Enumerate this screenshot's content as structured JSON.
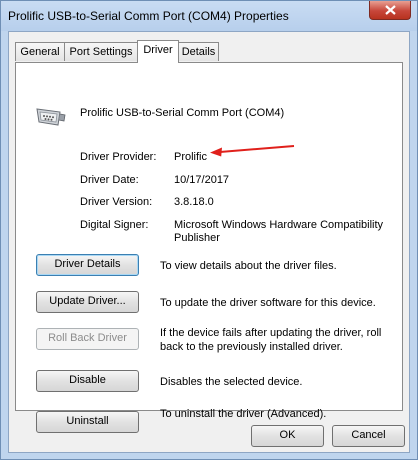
{
  "window": {
    "title": "Prolific USB-to-Serial Comm Port (COM4) Properties"
  },
  "tabs": [
    {
      "label": "General"
    },
    {
      "label": "Port Settings"
    },
    {
      "label": "Driver"
    },
    {
      "label": "Details"
    }
  ],
  "device": {
    "name": "Prolific USB-to-Serial Comm Port (COM4)",
    "icon": "serial-port-icon"
  },
  "driver_info": {
    "provider_label": "Driver Provider:",
    "provider_value": "Prolific",
    "date_label": "Driver Date:",
    "date_value": "10/17/2017",
    "version_label": "Driver Version:",
    "version_value": "3.8.18.0",
    "signer_label": "Digital Signer:",
    "signer_value_line1": "Microsoft Windows Hardware Compatibility",
    "signer_value_line2": "Publisher"
  },
  "actions": {
    "details_label": "Driver Details",
    "details_desc": "To view details about the driver files.",
    "update_label": "Update Driver...",
    "update_desc": "To update the driver software for this device.",
    "rollback_label": "Roll Back Driver",
    "rollback_desc_line1": "If the device fails after updating the driver, roll",
    "rollback_desc_line2": "back to the previously installed driver.",
    "disable_label": "Disable",
    "disable_desc": "Disables the selected device.",
    "uninstall_label": "Uninstall",
    "uninstall_desc": "To uninstall the driver (Advanced)."
  },
  "footer": {
    "ok_label": "OK",
    "cancel_label": "Cancel"
  },
  "colors": {
    "annotation_arrow": "#e0201b"
  }
}
